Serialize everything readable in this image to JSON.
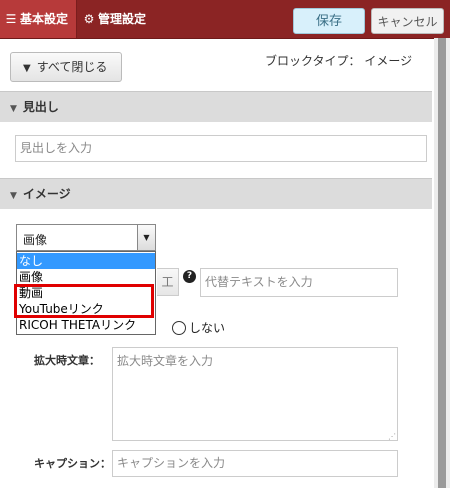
{
  "header": {
    "tabs": [
      {
        "label": "基本設定",
        "icon": "list-icon"
      },
      {
        "label": "管理設定",
        "icon": "gear-icon"
      }
    ],
    "save_label": "保存",
    "cancel_label": "キャンセル"
  },
  "toolbar": {
    "collapse_label": "すべて閉じる",
    "block_type": "ブロックタイプ： イメージ"
  },
  "sections": [
    {
      "title": "見出し",
      "input_placeholder": "見出しを入力"
    },
    {
      "title": "イメージ"
    }
  ],
  "image": {
    "select_value": "画像",
    "options": [
      "なし",
      "画像",
      "動画",
      "YouTubeリンク",
      "RICOH THETAリンク"
    ],
    "highlighted_options": [
      "動画",
      "YouTubeリンク"
    ],
    "edit_partial": "工",
    "alt_placeholder": "代替テキストを入力",
    "radio_label": "しない",
    "zoom_label": "拡大時文章：",
    "zoom_placeholder": "拡大時文章を入力",
    "caption_label": "キャプション：",
    "caption_placeholder": "キャプションを入力"
  },
  "colors": {
    "header_bg": "#8b2424",
    "active_tab": "#b73a3a",
    "highlight": "#e00000",
    "dropdown_selected": "#3399ff"
  }
}
